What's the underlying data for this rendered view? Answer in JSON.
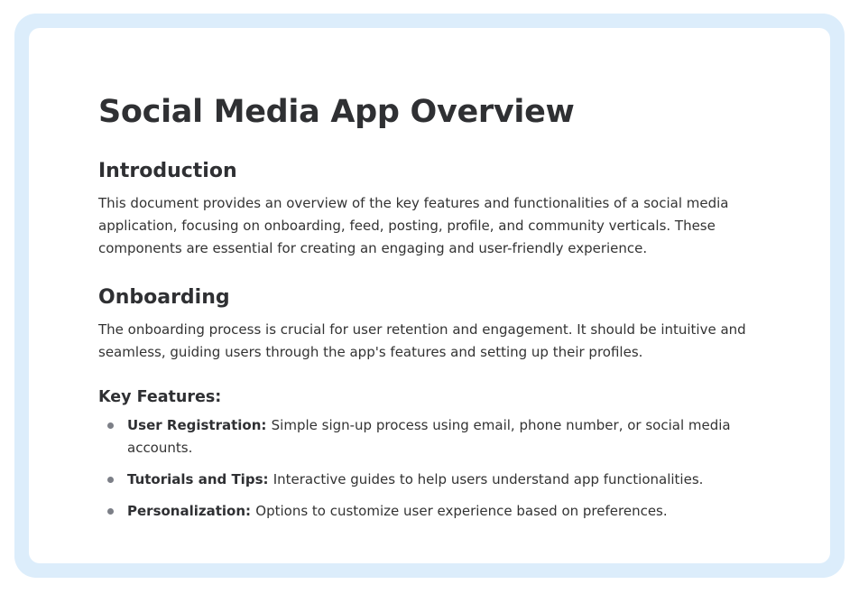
{
  "title": "Social Media App Overview",
  "introduction": {
    "heading": "Introduction",
    "body": "This document provides an overview of the key features and functionalities of a social media application, focusing on onboarding, feed, posting, profile, and community verticals. These components are essential for creating an engaging and user-friendly experience."
  },
  "onboarding": {
    "heading": "Onboarding",
    "body": "The onboarding process is crucial for user retention and engagement. It should be intuitive and seamless, guiding users through the app's features and setting up their profiles.",
    "features_heading": "Key Features:",
    "features": [
      {
        "term": "User Registration:",
        "description": "Simple sign-up process using email, phone number, or social media accounts."
      },
      {
        "term": "Tutorials and Tips:",
        "description": "Interactive guides to help users understand app functionalities."
      },
      {
        "term": "Personalization:",
        "description": "Options to customize user experience based on preferences."
      }
    ]
  }
}
